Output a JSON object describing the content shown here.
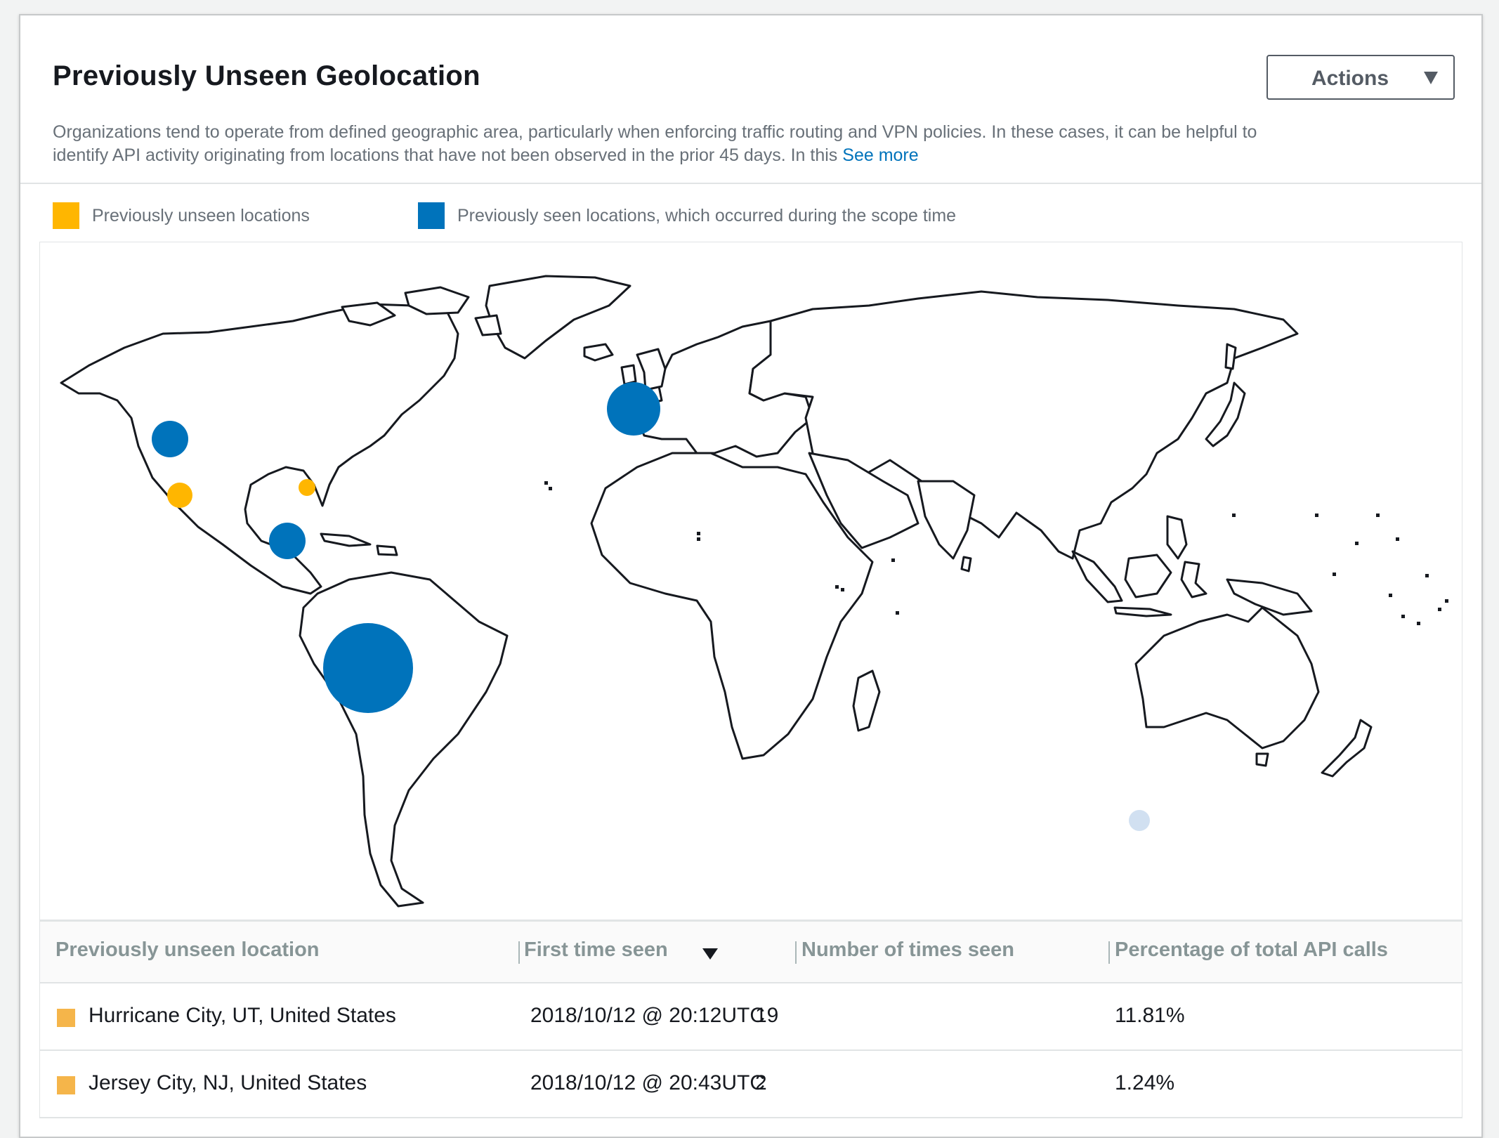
{
  "panel": {
    "title": "Previously Unseen Geolocation",
    "actions_label": "Actions",
    "description": "Organizations tend to operate from defined geographic area, particularly when enforcing traffic routing and VPN policies. In these cases, it can be helpful to identify API activity originating from locations that have not been observed in the prior 45 days. In this",
    "see_more": "See more"
  },
  "legend": {
    "unseen": {
      "label": "Previously unseen locations",
      "color": "#ffb600"
    },
    "seen": {
      "label": "Previously seen locations, which occurred during the scope time",
      "color": "#0073bb"
    }
  },
  "table": {
    "headers": [
      "Previously unseen location",
      "First time seen",
      "Number of times seen",
      "Percentage of total API calls"
    ],
    "rows": [
      {
        "location": "Hurricane City, UT, United States",
        "first_seen": "2018/10/12 @ 20:12UTC",
        "times_seen": "19",
        "percentage": "11.81%"
      },
      {
        "location": "Jersey City, NJ, United States",
        "first_seen": "2018/10/12 @ 20:43UTC",
        "times_seen": "2",
        "percentage": "1.24%"
      }
    ]
  },
  "map": {
    "markers": [
      {
        "id": "oregon",
        "type": "seen"
      },
      {
        "id": "ohio",
        "type": "seen"
      },
      {
        "id": "ireland",
        "type": "seen"
      },
      {
        "id": "brazil",
        "type": "seen"
      },
      {
        "id": "utah",
        "type": "unseen"
      },
      {
        "id": "new-jersey",
        "type": "unseen"
      },
      {
        "id": "perth",
        "type": "faded"
      }
    ]
  }
}
